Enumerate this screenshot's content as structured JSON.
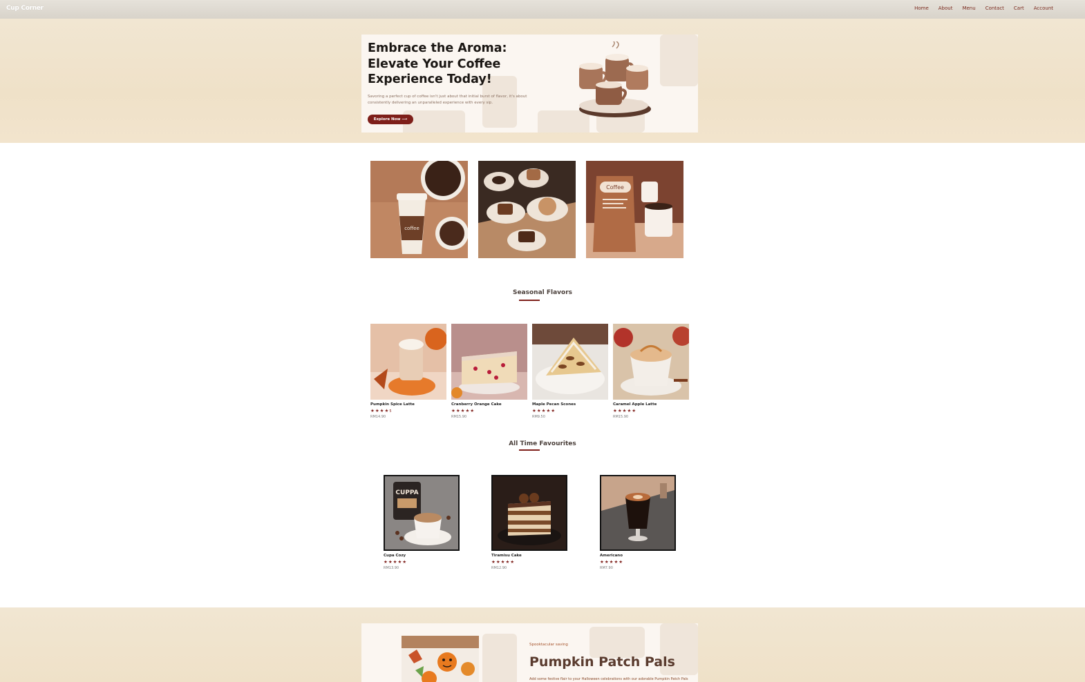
{
  "nav": {
    "brand": "Cup Corner",
    "links": [
      "Home",
      "About",
      "Menu",
      "Contact",
      "Cart",
      "Account"
    ]
  },
  "hero": {
    "title": "Embrace the Aroma: Elevate Your Coffee Experience Today!",
    "subtitle": "Savoring a perfect cup of coffee isn't just about that initial burst of flavor, it's about consistently delivering an unparalleled experience with every sip.",
    "button": "Explore Now ⟶"
  },
  "categories": [
    {
      "name": "coffee-cup-and-beans-image"
    },
    {
      "name": "pastries-and-coffee-image"
    },
    {
      "name": "coffee-bag-image"
    }
  ],
  "seasonal": {
    "title": "Seasonal Flavors",
    "items": [
      {
        "name": "Pumpkin Spice Latte",
        "stars": "★★★★",
        "rating": "5",
        "price": "RM14.90"
      },
      {
        "name": "Cranberry Orange Cake",
        "stars": "★★★★★",
        "price": "RM15.90"
      },
      {
        "name": "Maple Pecan Scones",
        "stars": "★★★★★",
        "price": "RM9.50"
      },
      {
        "name": "Caramel Apple Latte",
        "stars": "★★★★★",
        "price": "RM15.90"
      }
    ]
  },
  "favourites": {
    "title": "All Time Favourites",
    "items": [
      {
        "name": "Cupa Cozy",
        "stars": "★★★★★",
        "price": "RM13.90"
      },
      {
        "name": "Tiramisu Cake",
        "stars": "★★★★★",
        "price": "RM12.90"
      },
      {
        "name": "Americano",
        "stars": "★★★★★",
        "price": "RM7.90"
      }
    ]
  },
  "promo": {
    "kicker": "Spooktacular saving",
    "title": "Pumpkin Patch Pals",
    "text": "Add some festive flair to your Halloween celebrations with our adorable Pumpkin Patch Pals"
  },
  "colors": {
    "accent": "#7e1f1a",
    "band": "#efe1c8"
  }
}
